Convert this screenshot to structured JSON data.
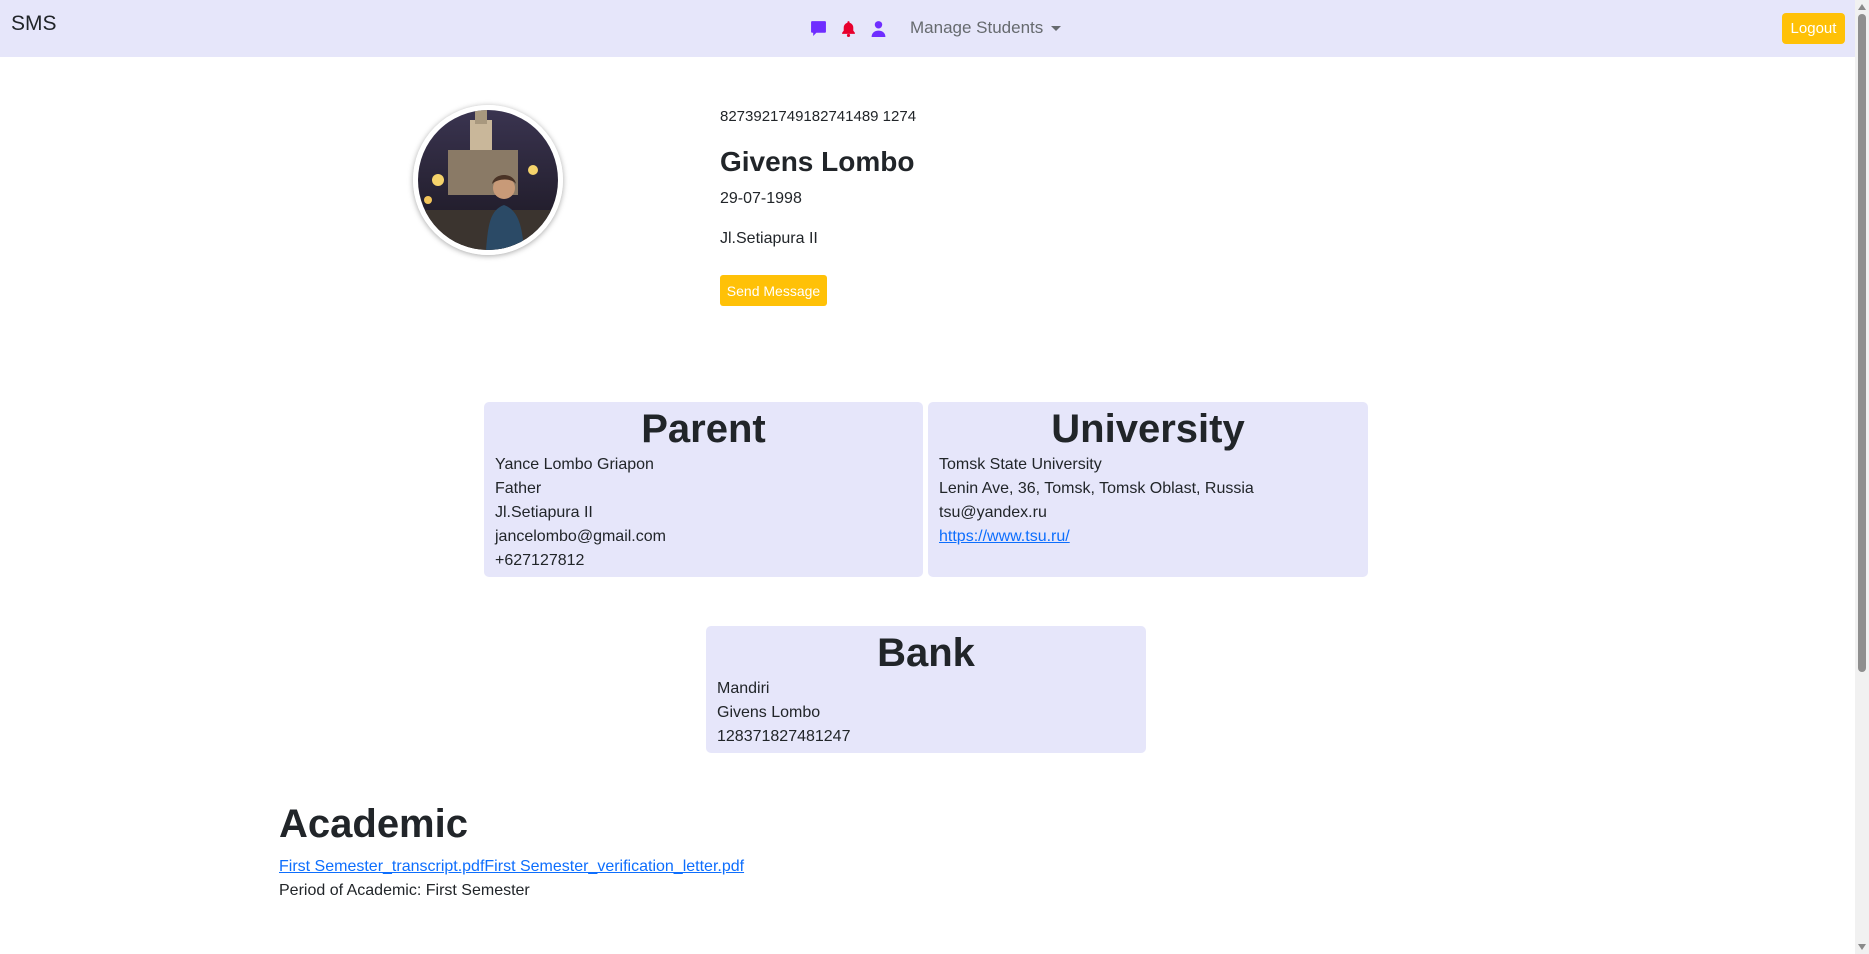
{
  "navbar": {
    "brand": "SMS",
    "icons": [
      "chat-icon",
      "bell-icon",
      "user-icon"
    ],
    "manage_label": "Manage Students",
    "logout_label": "Logout"
  },
  "profile": {
    "id": "8273921749182741489 1274",
    "name": "Givens Lombo",
    "dob": "29-07-1998",
    "address": "Jl.Setiapura II",
    "send_message_label": "Send Message"
  },
  "parent": {
    "title": "Parent",
    "name": "Yance Lombo Griapon",
    "relation": "Father",
    "address": "Jl.Setiapura II",
    "email": "jancelombo@gmail.com",
    "phone": "+627127812"
  },
  "university": {
    "title": "University",
    "name": "Tomsk State University",
    "address": "Lenin Ave, 36, Tomsk, Tomsk Oblast, Russia",
    "email": "tsu@yandex.ru",
    "website": "https://www.tsu.ru/"
  },
  "bank": {
    "title": "Bank",
    "bank_name": "Mandiri",
    "account_name": "Givens Lombo",
    "account_number": "128371827481247"
  },
  "academic": {
    "title": "Academic",
    "file1": "First Semester_transcript.pdf",
    "file2": "First Semester_verification_letter.pdf",
    "period": "Period of Academic: First Semester"
  },
  "colors": {
    "navbar_bg": "#e6e6fa",
    "card_bg": "#e6e6fa",
    "accent": "#ffc107",
    "chat_icon": "#6f2dff",
    "bell_icon": "#e8002d",
    "user_icon": "#6f2dff",
    "link": "#0d6efd"
  }
}
